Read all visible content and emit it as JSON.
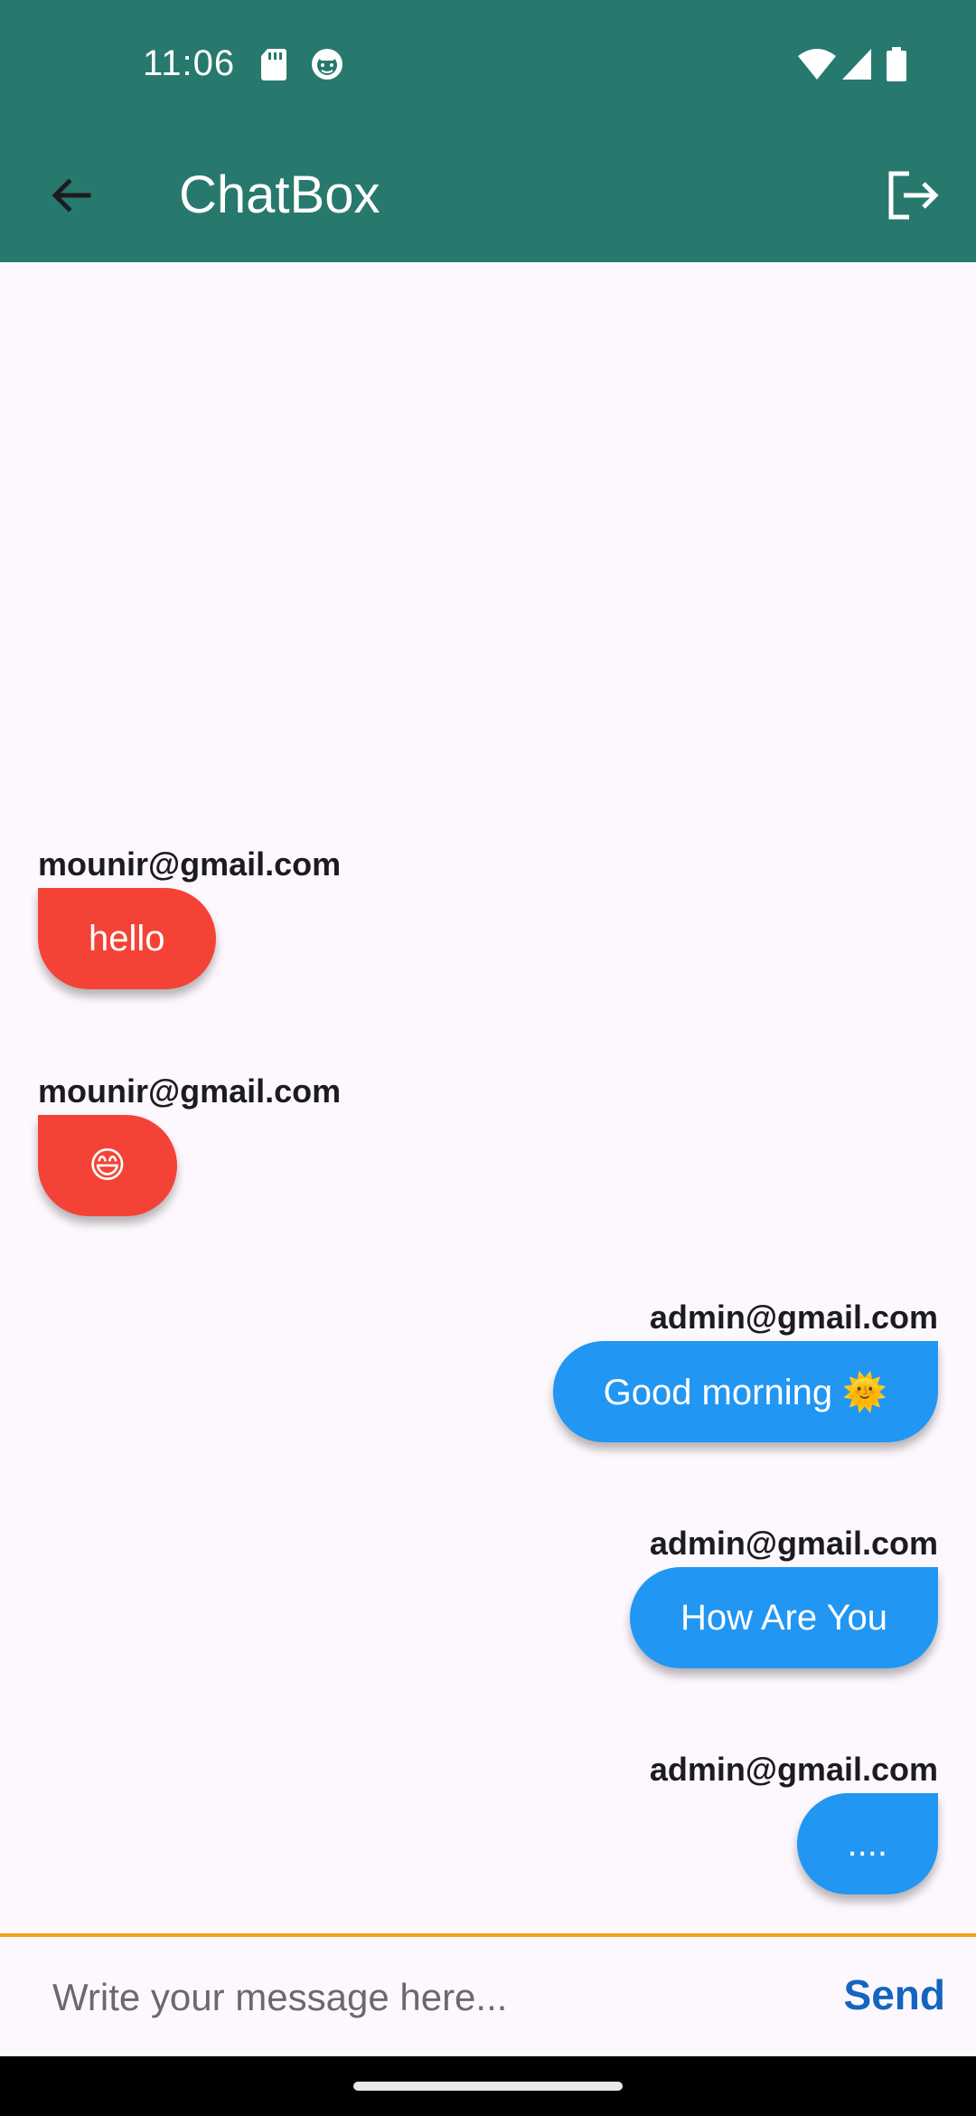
{
  "status_bar": {
    "time": "11:06",
    "icons": [
      "sd-card-icon",
      "face-icon",
      "wifi-icon",
      "signal-icon",
      "battery-icon"
    ]
  },
  "app_bar": {
    "title": "ChatBox",
    "back_icon": "arrow-back-icon",
    "logout_icon": "logout-icon"
  },
  "messages": [
    {
      "sender": "mounir@gmail.com",
      "text": "hello",
      "side": "left"
    },
    {
      "sender": "mounir@gmail.com",
      "text": "😄",
      "side": "left"
    },
    {
      "sender": "admin@gmail.com",
      "text": "Good morning  🌞",
      "side": "right"
    },
    {
      "sender": "admin@gmail.com",
      "text": "How Are You",
      "side": "right"
    },
    {
      "sender": "admin@gmail.com",
      "text": "....",
      "side": "right"
    }
  ],
  "composer": {
    "placeholder": "Write your message here...",
    "value": "",
    "send_label": "Send"
  },
  "colors": {
    "app_bar": "#27796d",
    "incoming_bubble": "#f44336",
    "outgoing_bubble": "#2196f3",
    "composer_border": "#f4a01a",
    "send": "#1565c0"
  }
}
